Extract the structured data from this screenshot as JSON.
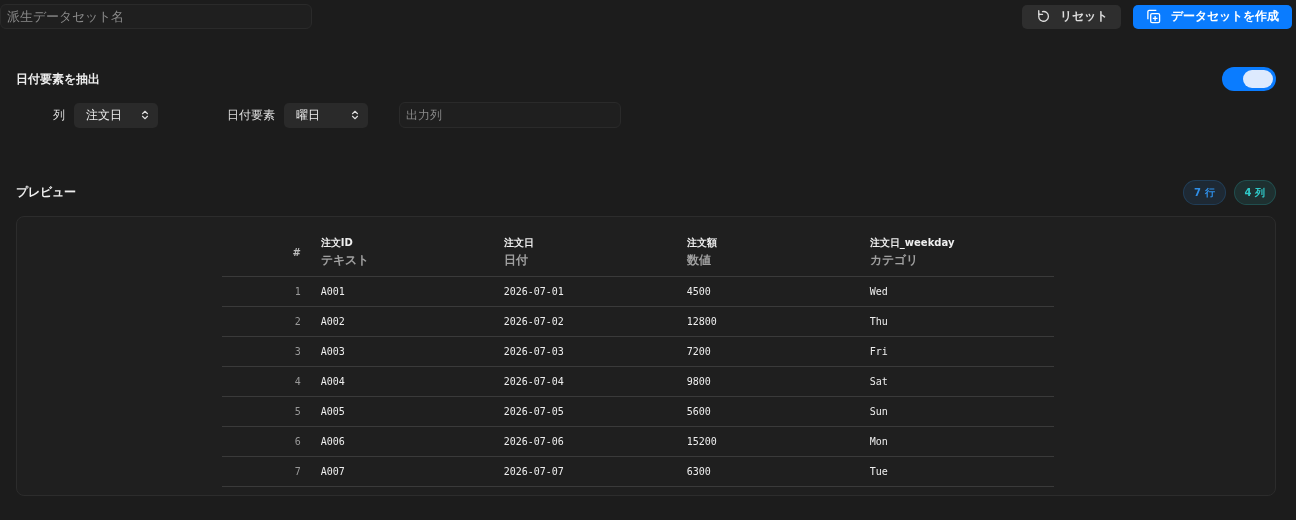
{
  "header": {
    "name_field": {
      "placeholder": "派生データセット名"
    },
    "buttons": [
      {
        "kind": "secondary",
        "label": "リセット"
      },
      {
        "kind": "primary",
        "label": "データセットを作成"
      }
    ]
  },
  "extract": {
    "title": "日付要素を抽出",
    "enabled": true,
    "column_label": "列",
    "column_value": "注文日",
    "part_label": "日付要素",
    "part_value": "曜日",
    "output_field": {
      "placeholder": "出力列"
    }
  },
  "preview": {
    "title": "プレビュー",
    "badges": [
      {
        "text": "7 行",
        "color": "#2f8fe8"
      },
      {
        "text": "4 列",
        "color": "#2fc8c8"
      }
    ],
    "table": {
      "index_header": "#",
      "columns": [
        {
          "name": "注文ID",
          "type": "テキスト"
        },
        {
          "name": "注文日",
          "type": "日付"
        },
        {
          "name": "注文額",
          "type": "数値"
        },
        {
          "name": "注文日_weekday",
          "type": "カテゴリ"
        }
      ],
      "rows": [
        {
          "index": "1",
          "cells": [
            "A001",
            "2026-07-01",
            "4500",
            "Wed"
          ]
        },
        {
          "index": "2",
          "cells": [
            "A002",
            "2026-07-02",
            "12800",
            "Thu"
          ]
        },
        {
          "index": "3",
          "cells": [
            "A003",
            "2026-07-03",
            "7200",
            "Fri"
          ]
        },
        {
          "index": "4",
          "cells": [
            "A004",
            "2026-07-04",
            "9800",
            "Sat"
          ]
        },
        {
          "index": "5",
          "cells": [
            "A005",
            "2026-07-05",
            "5600",
            "Sun"
          ]
        },
        {
          "index": "6",
          "cells": [
            "A006",
            "2026-07-06",
            "15200",
            "Mon"
          ]
        },
        {
          "index": "7",
          "cells": [
            "A007",
            "2026-07-07",
            "6300",
            "Tue"
          ]
        }
      ]
    }
  }
}
